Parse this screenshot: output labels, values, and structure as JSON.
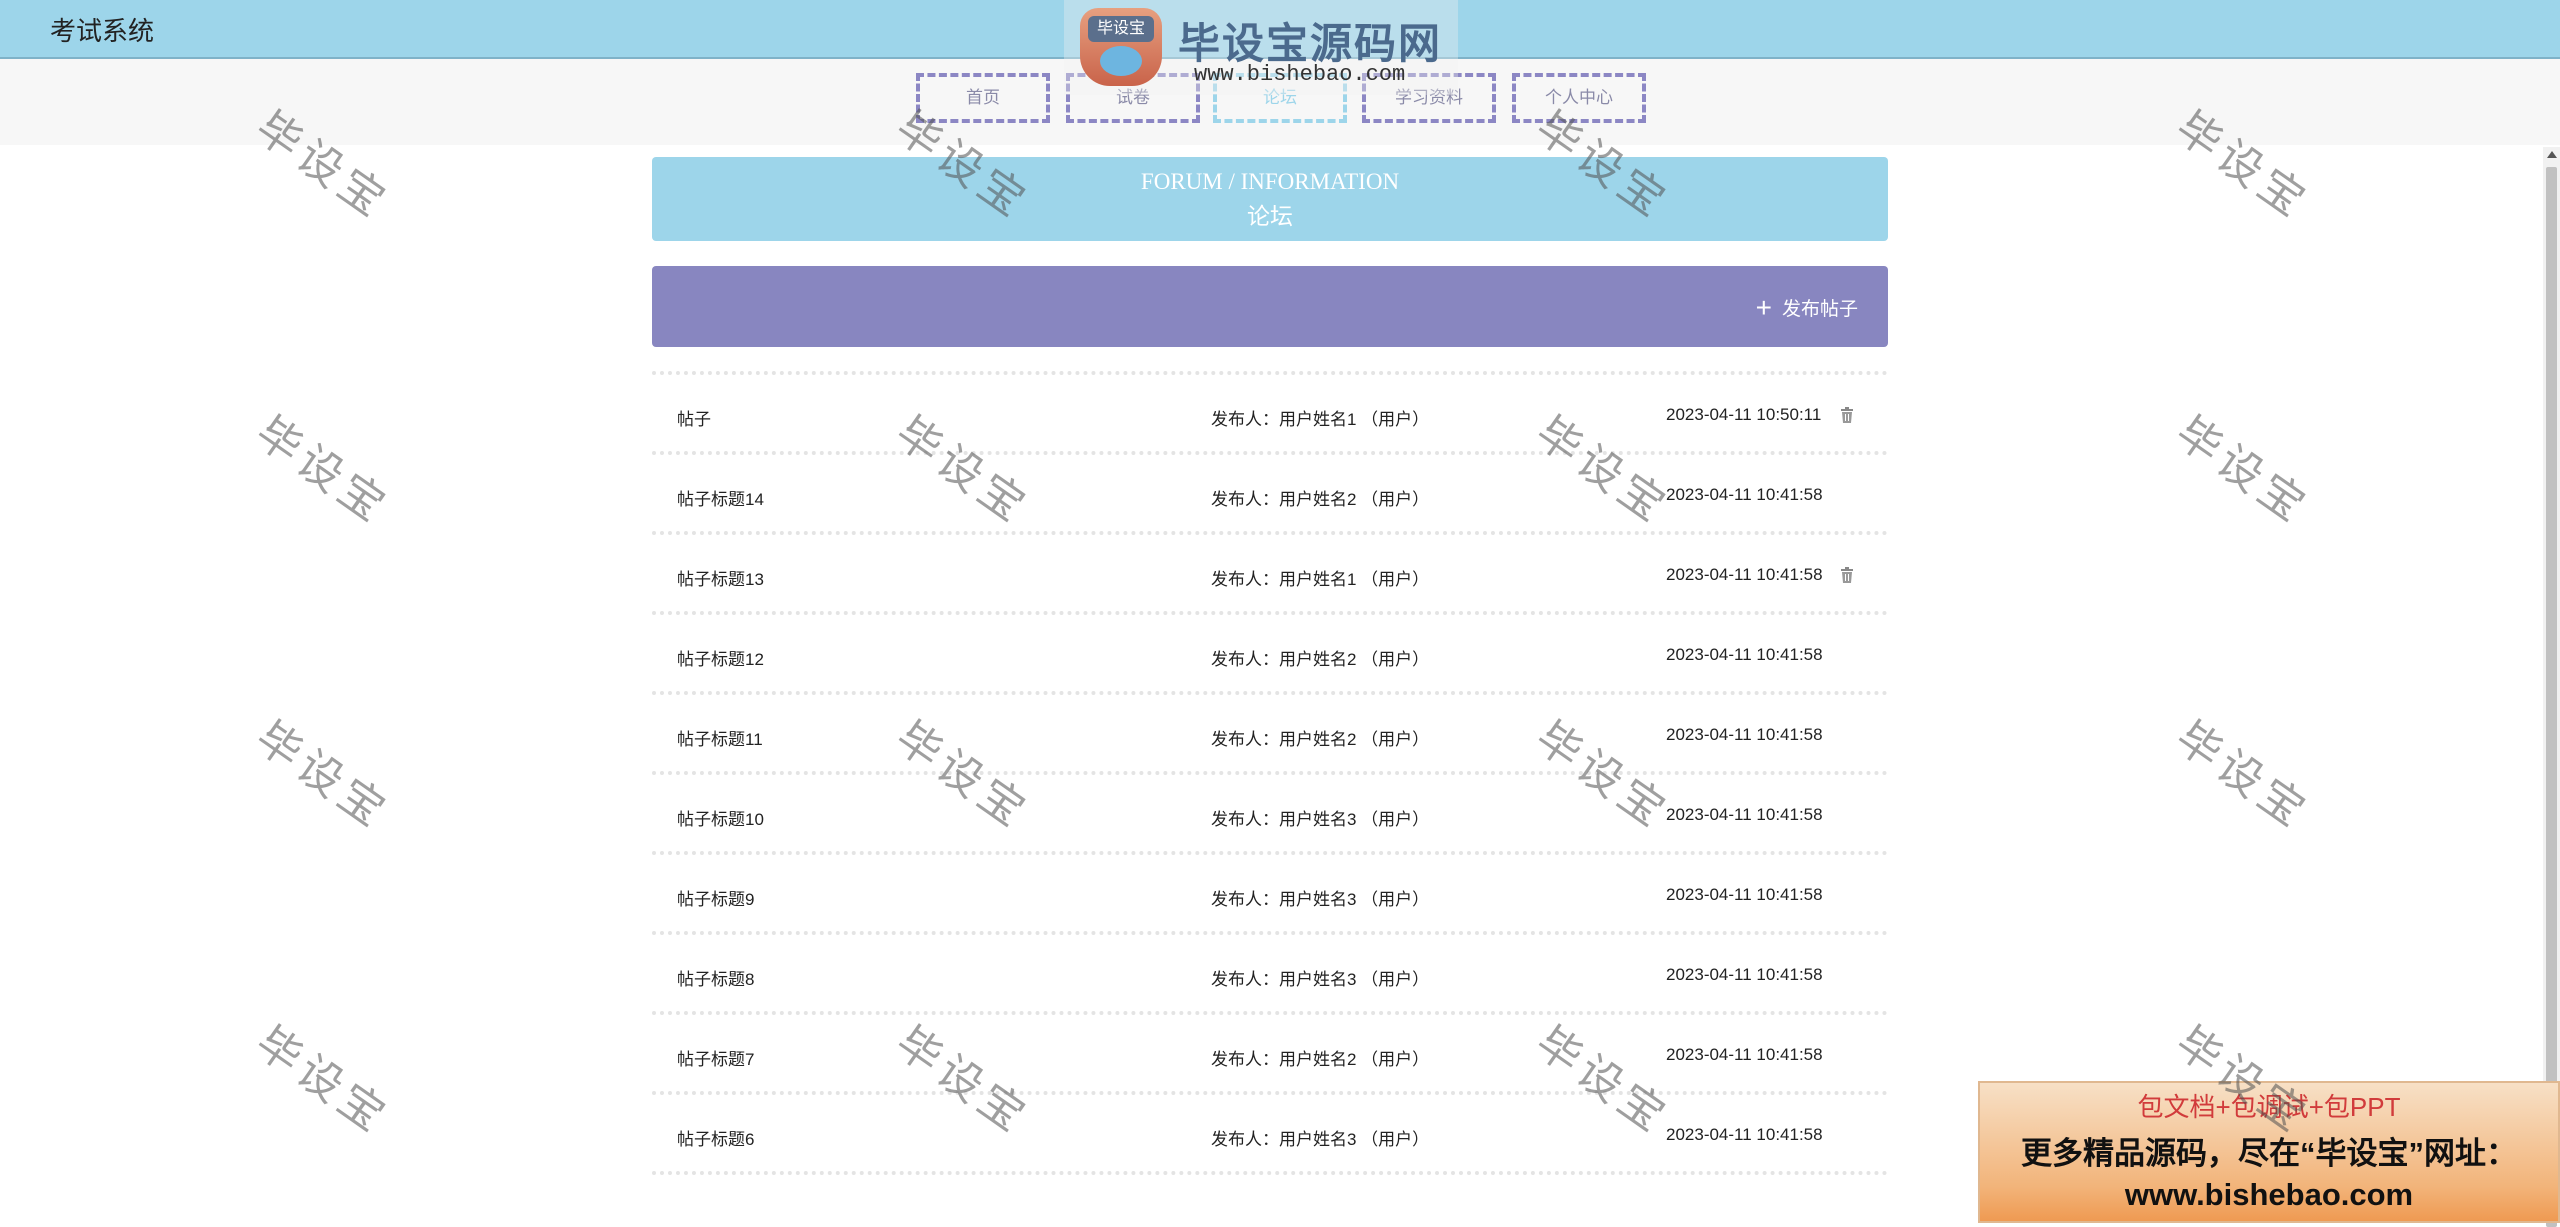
{
  "app": {
    "title": "考试系统"
  },
  "nav": {
    "items": [
      {
        "label": "首页"
      },
      {
        "label": "试卷"
      },
      {
        "label": "论坛",
        "active": true
      },
      {
        "label": "学习资料"
      },
      {
        "label": "个人中心"
      }
    ]
  },
  "banner": {
    "en": "FORUM / INFORMATION",
    "cn": "论坛"
  },
  "toolbar": {
    "post_label": "发布帖子",
    "post_icon": "plus-icon"
  },
  "posts": [
    {
      "title": "帖子",
      "author": "发布人：用户姓名1 （用户）",
      "time": "2023-04-11 10:50:11",
      "deletable": true
    },
    {
      "title": "帖子标题14",
      "author": "发布人：用户姓名2 （用户）",
      "time": "2023-04-11 10:41:58",
      "deletable": false
    },
    {
      "title": "帖子标题13",
      "author": "发布人：用户姓名1 （用户）",
      "time": "2023-04-11 10:41:58",
      "deletable": true
    },
    {
      "title": "帖子标题12",
      "author": "发布人：用户姓名2 （用户）",
      "time": "2023-04-11 10:41:58",
      "deletable": false
    },
    {
      "title": "帖子标题11",
      "author": "发布人：用户姓名2 （用户）",
      "time": "2023-04-11 10:41:58",
      "deletable": false
    },
    {
      "title": "帖子标题10",
      "author": "发布人：用户姓名3 （用户）",
      "time": "2023-04-11 10:41:58",
      "deletable": false
    },
    {
      "title": "帖子标题9",
      "author": "发布人：用户姓名3 （用户）",
      "time": "2023-04-11 10:41:58",
      "deletable": false
    },
    {
      "title": "帖子标题8",
      "author": "发布人：用户姓名3 （用户）",
      "time": "2023-04-11 10:41:58",
      "deletable": false
    },
    {
      "title": "帖子标题7",
      "author": "发布人：用户姓名2 （用户）",
      "time": "2023-04-11 10:41:58",
      "deletable": false
    },
    {
      "title": "帖子标题6",
      "author": "发布人：用户姓名3 （用户）",
      "time": "2023-04-11 10:41:58",
      "deletable": false
    }
  ],
  "watermark": {
    "text": "毕设宝"
  },
  "logo": {
    "brand": "毕设宝源码网",
    "badge": "毕设宝",
    "url": "www.bishebao.com"
  },
  "ad": {
    "line1": "包文档+包调试+包PPT",
    "line2": "更多精品源码，尽在“毕设宝”网址：",
    "line3": "www.bishebao.com"
  },
  "colors": {
    "header": "#9dd5ea",
    "banner": "#9dd5ea",
    "toolbar": "#8886c0",
    "nav_border": "#8c87c4"
  }
}
